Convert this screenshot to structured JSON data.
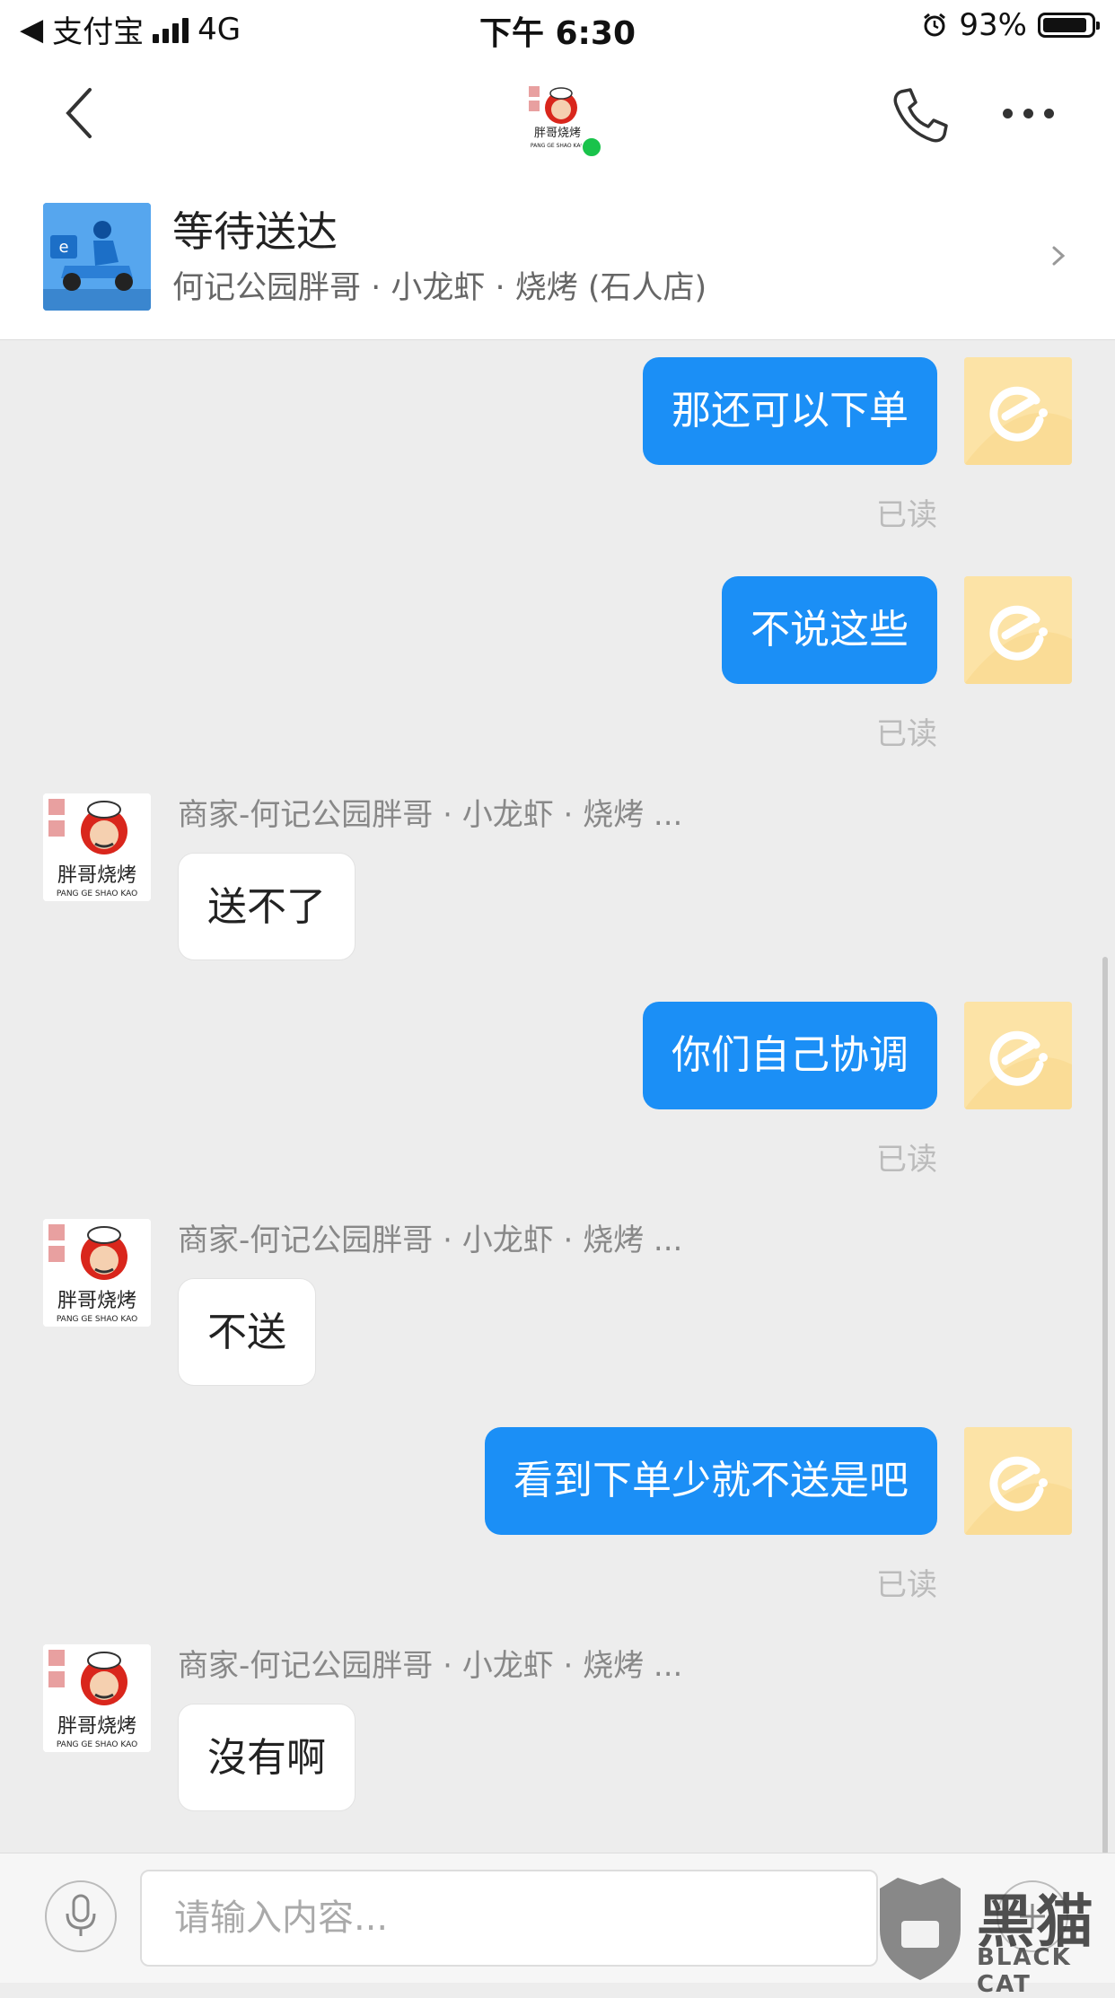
{
  "status_bar": {
    "back_app": "支付宝",
    "network": "4G",
    "time": "下午 6:30",
    "battery_pct": "93%",
    "battery_level": 0.93
  },
  "nav": {
    "logo_icon": "pangge-shaokao-logo",
    "online": true
  },
  "order": {
    "status": "等待送达",
    "shop": "何记公园胖哥 · 小龙虾 · 烧烤 (石人店)"
  },
  "colors": {
    "my_bubble": "#1b8ff6",
    "online_dot": "#19c34b",
    "background": "#ededed"
  },
  "messages": [
    {
      "from": "me",
      "text": "那还可以下单",
      "status": "已读"
    },
    {
      "from": "me",
      "text": "不说这些",
      "status": "已读"
    },
    {
      "from": "shop",
      "sender": "商家-何记公园胖哥 · 小龙虾 · 烧烤 ...",
      "text": "送不了"
    },
    {
      "from": "me",
      "text": "你们自己协调",
      "status": "已读"
    },
    {
      "from": "shop",
      "sender": "商家-何记公园胖哥 · 小龙虾 · 烧烤 ...",
      "text": "不送"
    },
    {
      "from": "me",
      "text": "看到下单少就不送是吧",
      "status": "已读"
    },
    {
      "from": "shop",
      "sender": "商家-何记公园胖哥 · 小龙虾 · 烧烤 ...",
      "text": "沒有啊"
    }
  ],
  "input": {
    "placeholder": "请输入内容..."
  },
  "watermark": {
    "title": "黑猫",
    "subtitle": "BLACK CAT"
  }
}
